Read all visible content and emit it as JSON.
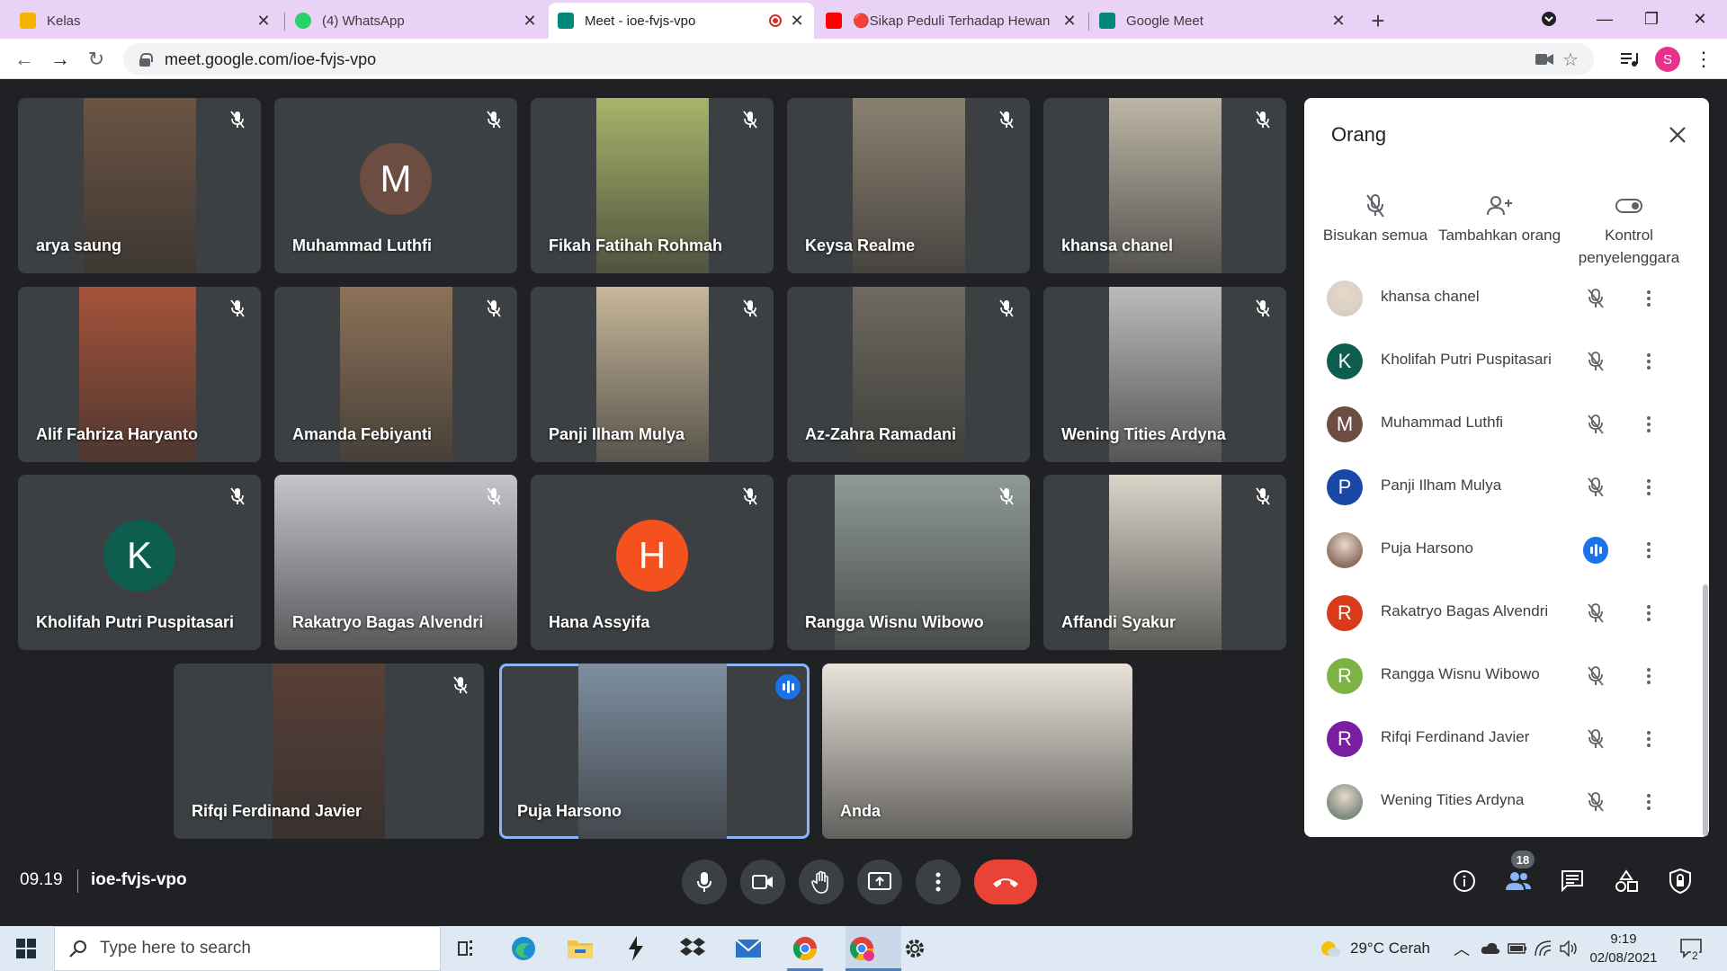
{
  "browser": {
    "tabs": [
      {
        "title": "Kelas",
        "favicon": "google-classroom-icon",
        "color": "#f5b400"
      },
      {
        "title": "(4) WhatsApp",
        "favicon": "whatsapp-icon",
        "color": "#25d366"
      },
      {
        "title": "Meet - ioe-fvjs-vpo",
        "favicon": "google-meet-icon",
        "color": "#00897b"
      },
      {
        "title": "🔴Sikap Peduli Terhadap Hewan",
        "favicon": "youtube-icon",
        "color": "#ff0000"
      },
      {
        "title": "Google Meet",
        "favicon": "google-meet-icon",
        "color": "#00897b"
      }
    ],
    "url": "meet.google.com/ioe-fvjs-vpo",
    "profile_initial": "S"
  },
  "tiles": [
    {
      "name": "arya saung",
      "kind": "video",
      "bg": "#6b5443"
    },
    {
      "name": "Muhammad Luthfi",
      "kind": "avatar",
      "initial": "M",
      "color": "#6d4c41"
    },
    {
      "name": "Fikah Fatihah Rohmah",
      "kind": "video",
      "bg": "#a9b46a"
    },
    {
      "name": "Keysa Realme",
      "kind": "video",
      "bg": "#8a8070"
    },
    {
      "name": "khansa chanel",
      "kind": "video",
      "bg": "#bdb6a6"
    },
    {
      "name": "Alif Fahriza Haryanto",
      "kind": "video",
      "bg": "#a5533a"
    },
    {
      "name": "Amanda Febiyanti",
      "kind": "video",
      "bg": "#8c7258"
    },
    {
      "name": "Panji Ilham Mulya",
      "kind": "video",
      "bg": "#c7b79a"
    },
    {
      "name": "Az-Zahra Ramadani",
      "kind": "video",
      "bg": "#6e6a60"
    },
    {
      "name": "Wening Tities Ardyna",
      "kind": "video",
      "bg": "#b9bcb8"
    },
    {
      "name": "Kholifah Putri Puspitasari",
      "kind": "avatar",
      "initial": "K",
      "color": "#0d5e4e"
    },
    {
      "name": "Rakatryo Bagas Alvendri",
      "kind": "video",
      "bg": "#c4c6cc"
    },
    {
      "name": "Hana Assyifa",
      "kind": "avatar",
      "initial": "H",
      "color": "#f4511e"
    },
    {
      "name": "Rangga Wisnu Wibowo",
      "kind": "video",
      "bg": "#8f9a96"
    },
    {
      "name": "Affandi Syakur",
      "kind": "video",
      "bg": "#d8d4c8"
    },
    {
      "name": "Rifqi Ferdinand Javier",
      "kind": "video",
      "bg": "#5a4038"
    },
    {
      "name": "Puja Harsono",
      "kind": "video",
      "bg": "#7d8fa0",
      "speaking": true
    },
    {
      "name": "Anda",
      "kind": "video",
      "bg": "#e9e3da"
    }
  ],
  "meet": {
    "time": "09.19",
    "code": "ioe-fvjs-vpo",
    "participant_count": "18",
    "controls": [
      "mic-icon",
      "camera-icon",
      "raise-hand-icon",
      "present-screen-icon",
      "more-options-icon",
      "end-call-icon"
    ],
    "right_controls": [
      "info-icon",
      "people-icon",
      "chat-icon",
      "activities-icon",
      "host-controls-icon"
    ]
  },
  "people_panel": {
    "title": "Orang",
    "actions": [
      {
        "label": "Bisukan semua",
        "icon": "mute-all-icon"
      },
      {
        "label": "Tambahkan orang",
        "icon": "add-person-icon"
      },
      {
        "label": "Kontrol penyelenggara",
        "icon": "toggle-icon"
      }
    ],
    "participants": [
      {
        "name": "khansa chanel",
        "initial": "",
        "color": "#d8cfc4",
        "photo": true
      },
      {
        "name": "Kholifah Putri Puspitasari",
        "initial": "K",
        "color": "#0d5e4e"
      },
      {
        "name": "Muhammad Luthfi",
        "initial": "M",
        "color": "#6d4c41"
      },
      {
        "name": "Panji Ilham Mulya",
        "initial": "P",
        "color": "#1a47a8"
      },
      {
        "name": "Puja Harsono",
        "initial": "",
        "color": "#8d6e63",
        "photo": true,
        "speaking": true
      },
      {
        "name": "Rakatryo Bagas Alvendri",
        "initial": "R",
        "color": "#d93b1a"
      },
      {
        "name": "Rangga Wisnu Wibowo",
        "initial": "R",
        "color": "#7cb342"
      },
      {
        "name": "Rifqi Ferdinand Javier",
        "initial": "R",
        "color": "#7b1fa2"
      },
      {
        "name": "Wening Tities Ardyna",
        "initial": "",
        "color": "#7d8a80",
        "photo": true
      }
    ]
  },
  "taskbar": {
    "search_placeholder": "Type here to search",
    "weather": "29°C  Cerah",
    "clock_time": "9:19",
    "clock_date": "02/08/2021",
    "notifications": "2"
  }
}
